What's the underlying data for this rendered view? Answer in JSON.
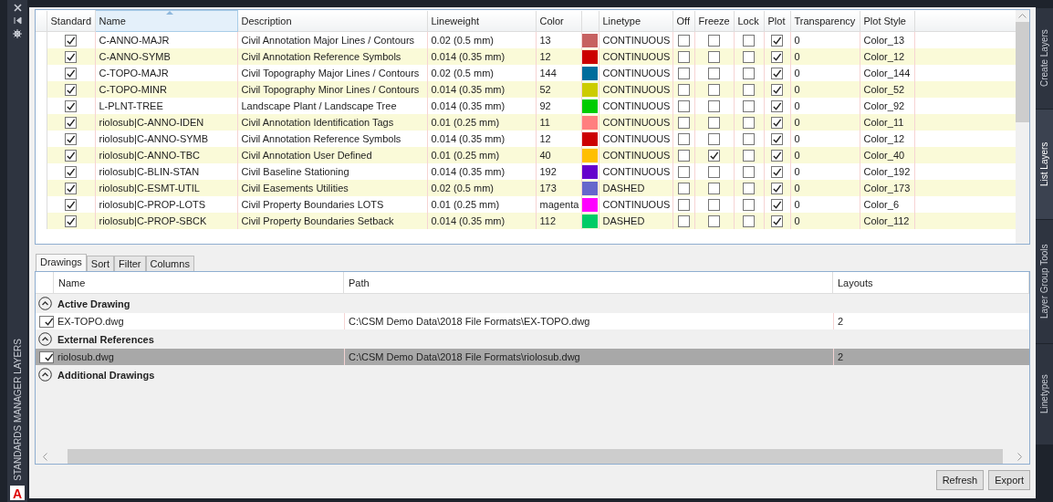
{
  "palette": {
    "title": "STANDARDS MANAGER LAYERS",
    "logo": "A"
  },
  "layers": {
    "columns": [
      "Standard",
      "Name",
      "Description",
      "Lineweight",
      "Color",
      "Linetype",
      "Off",
      "Freeze",
      "Lock",
      "Plot",
      "Transparency",
      "Plot Style"
    ],
    "rows": [
      {
        "standard": true,
        "name": "C-ANNO-MAJR",
        "description": "Civil Annotation Major Lines / Contours",
        "lineweight": "0.02 (0.5 mm)",
        "color_label": "13",
        "color": "#c76161",
        "linetype": "CONTINUOUS",
        "off": false,
        "freeze": false,
        "lock": false,
        "plot": true,
        "transparency": "0",
        "plot_style": "Color_13"
      },
      {
        "standard": true,
        "name": "C-ANNO-SYMB",
        "description": "Civil Annotation Reference Symbols",
        "lineweight": "0.014 (0.35 mm)",
        "color_label": "12",
        "color": "#cc0000",
        "linetype": "CONTINUOUS",
        "off": false,
        "freeze": false,
        "lock": false,
        "plot": true,
        "transparency": "0",
        "plot_style": "Color_12"
      },
      {
        "standard": true,
        "name": "C-TOPO-MAJR",
        "description": "Civil Topography Major Lines / Contours",
        "lineweight": "0.02 (0.5 mm)",
        "color_label": "144",
        "color": "#006d9c",
        "linetype": "CONTINUOUS",
        "off": false,
        "freeze": false,
        "lock": false,
        "plot": true,
        "transparency": "0",
        "plot_style": "Color_144"
      },
      {
        "standard": true,
        "name": "C-TOPO-MINR",
        "description": "Civil Topography Minor Lines / Contours",
        "lineweight": "0.014 (0.35 mm)",
        "color_label": "52",
        "color": "#cccc00",
        "linetype": "CONTINUOUS",
        "off": false,
        "freeze": false,
        "lock": false,
        "plot": true,
        "transparency": "0",
        "plot_style": "Color_52"
      },
      {
        "standard": true,
        "name": "L-PLNT-TREE",
        "description": "Landscape Plant / Landscape Tree",
        "lineweight": "0.014 (0.35 mm)",
        "color_label": "92",
        "color": "#00cc00",
        "linetype": "CONTINUOUS",
        "off": false,
        "freeze": false,
        "lock": false,
        "plot": true,
        "transparency": "0",
        "plot_style": "Color_92"
      },
      {
        "standard": true,
        "name": "riolosub|C-ANNO-IDEN",
        "description": "Civil Annotation Identification Tags",
        "lineweight": "0.01 (0.25 mm)",
        "color_label": "11",
        "color": "#ff7f7f",
        "linetype": "CONTINUOUS",
        "off": false,
        "freeze": false,
        "lock": false,
        "plot": true,
        "transparency": "0",
        "plot_style": "Color_11"
      },
      {
        "standard": true,
        "name": "riolosub|C-ANNO-SYMB",
        "description": "Civil Annotation Reference Symbols",
        "lineweight": "0.014 (0.35 mm)",
        "color_label": "12",
        "color": "#cc0000",
        "linetype": "CONTINUOUS",
        "off": false,
        "freeze": false,
        "lock": false,
        "plot": true,
        "transparency": "0",
        "plot_style": "Color_12"
      },
      {
        "standard": true,
        "name": "riolosub|C-ANNO-TBC",
        "description": "Civil Annotation User Defined",
        "lineweight": "0.01 (0.25 mm)",
        "color_label": "40",
        "color": "#ffbf00",
        "linetype": "CONTINUOUS",
        "off": false,
        "freeze": true,
        "lock": false,
        "plot": true,
        "transparency": "0",
        "plot_style": "Color_40"
      },
      {
        "standard": true,
        "name": "riolosub|C-BLIN-STAN",
        "description": "Civil Baseline Stationing",
        "lineweight": "0.014 (0.35 mm)",
        "color_label": "192",
        "color": "#6600cc",
        "linetype": "CONTINUOUS",
        "off": false,
        "freeze": false,
        "lock": false,
        "plot": true,
        "transparency": "0",
        "plot_style": "Color_192"
      },
      {
        "standard": true,
        "name": "riolosub|C-ESMT-UTIL",
        "description": "Civil Easements Utilities",
        "lineweight": "0.02 (0.5 mm)",
        "color_label": "173",
        "color": "#6666cc",
        "linetype": "DASHED",
        "off": false,
        "freeze": false,
        "lock": false,
        "plot": true,
        "transparency": "0",
        "plot_style": "Color_173"
      },
      {
        "standard": true,
        "name": "riolosub|C-PROP-LOTS",
        "description": "Civil Property Boundaries LOTS",
        "lineweight": "0.01 (0.25 mm)",
        "color_label": "magenta",
        "color": "#ff00ff",
        "linetype": "CONTINUOUS",
        "off": false,
        "freeze": false,
        "lock": false,
        "plot": true,
        "transparency": "0",
        "plot_style": "Color_6"
      },
      {
        "standard": true,
        "name": "riolosub|C-PROP-SBCK",
        "description": "Civil Property Boundaries Setback",
        "lineweight": "0.014 (0.35 mm)",
        "color_label": "112",
        "color": "#00cc66",
        "linetype": "DASHED",
        "off": false,
        "freeze": false,
        "lock": false,
        "plot": true,
        "transparency": "0",
        "plot_style": "Color_112"
      }
    ]
  },
  "tabs": [
    {
      "label": "Drawings",
      "selected": true
    },
    {
      "label": "Sort",
      "selected": false
    },
    {
      "label": "Filter",
      "selected": false
    },
    {
      "label": "Columns",
      "selected": false
    }
  ],
  "drawings": {
    "columns": [
      "Name",
      "Path",
      "Layouts"
    ],
    "groups": [
      {
        "title": "Active Drawing",
        "expanded": true,
        "items": [
          {
            "checked": true,
            "selected": false,
            "name": "EX-TOPO.dwg",
            "path": "C:\\CSM Demo Data\\2018 File Formats\\EX-TOPO.dwg",
            "layouts": "2"
          }
        ]
      },
      {
        "title": "External References",
        "expanded": true,
        "items": [
          {
            "checked": true,
            "selected": true,
            "name": "riolosub.dwg",
            "path": "C:\\CSM Demo Data\\2018 File Formats\\riolosub.dwg",
            "layouts": "2"
          }
        ]
      },
      {
        "title": "Additional Drawings",
        "expanded": true
      }
    ]
  },
  "buttons": [
    "Refresh",
    "Export"
  ],
  "side_tabs": [
    {
      "label": "Create Layers",
      "selected": false
    },
    {
      "label": "List Layers",
      "selected": true
    },
    {
      "label": "Layer Group Tools",
      "selected": false
    },
    {
      "label": "Linetypes",
      "selected": false
    }
  ]
}
